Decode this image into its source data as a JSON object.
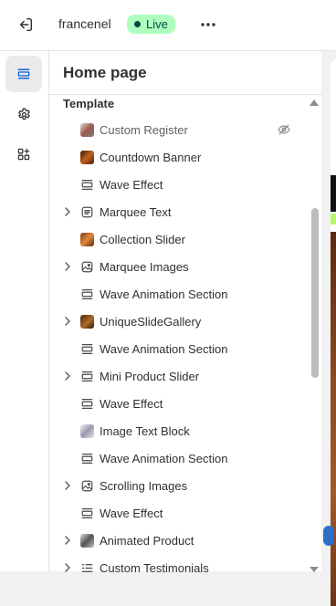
{
  "topbar": {
    "store_name": "francenel",
    "status_badge": "Live"
  },
  "colors": {
    "accent": "#005bd3",
    "live_badge_bg": "#affebf",
    "live_badge_text": "#014b40"
  },
  "siderail": {
    "items": [
      {
        "name": "sections",
        "icon": "sections-icon",
        "active": true
      },
      {
        "name": "theme-settings",
        "icon": "gear-icon",
        "active": false
      },
      {
        "name": "app-embeds",
        "icon": "apps-icon",
        "active": false
      }
    ]
  },
  "panel": {
    "title": "Home page",
    "section_header": "Template",
    "items": [
      {
        "label": "Custom Register",
        "icon": "image-thumbnail-icon",
        "expandable": false,
        "hidden": true
      },
      {
        "label": "Countdown Banner",
        "icon": "image-thumbnail-icon",
        "expandable": false,
        "hidden": false
      },
      {
        "label": "Wave Effect",
        "icon": "section-icon",
        "expandable": false,
        "hidden": false
      },
      {
        "label": "Marquee Text",
        "icon": "text-block-icon",
        "expandable": true,
        "hidden": false
      },
      {
        "label": "Collection Slider",
        "icon": "image-thumbnail-icon",
        "expandable": false,
        "hidden": false
      },
      {
        "label": "Marquee Images",
        "icon": "image-icon",
        "expandable": true,
        "hidden": false
      },
      {
        "label": "Wave Animation Section",
        "icon": "section-icon",
        "expandable": false,
        "hidden": false
      },
      {
        "label": "UniqueSlideGallery",
        "icon": "image-thumbnail-icon",
        "expandable": true,
        "hidden": false
      },
      {
        "label": "Wave Animation Section",
        "icon": "section-icon",
        "expandable": false,
        "hidden": false
      },
      {
        "label": "Mini Product Slider",
        "icon": "section-icon",
        "expandable": true,
        "hidden": false
      },
      {
        "label": "Wave Effect",
        "icon": "section-icon",
        "expandable": false,
        "hidden": false
      },
      {
        "label": "Image Text Block",
        "icon": "image-thumbnail-icon",
        "expandable": false,
        "hidden": false
      },
      {
        "label": "Wave Animation Section",
        "icon": "section-icon",
        "expandable": false,
        "hidden": false
      },
      {
        "label": "Scrolling Images",
        "icon": "image-icon",
        "expandable": true,
        "hidden": false
      },
      {
        "label": "Wave Effect",
        "icon": "section-icon",
        "expandable": false,
        "hidden": false
      },
      {
        "label": "Animated Product",
        "icon": "image-thumbnail-icon",
        "expandable": true,
        "hidden": false
      },
      {
        "label": "Custom Testimonials",
        "icon": "list-icon",
        "expandable": true,
        "hidden": false
      }
    ]
  }
}
